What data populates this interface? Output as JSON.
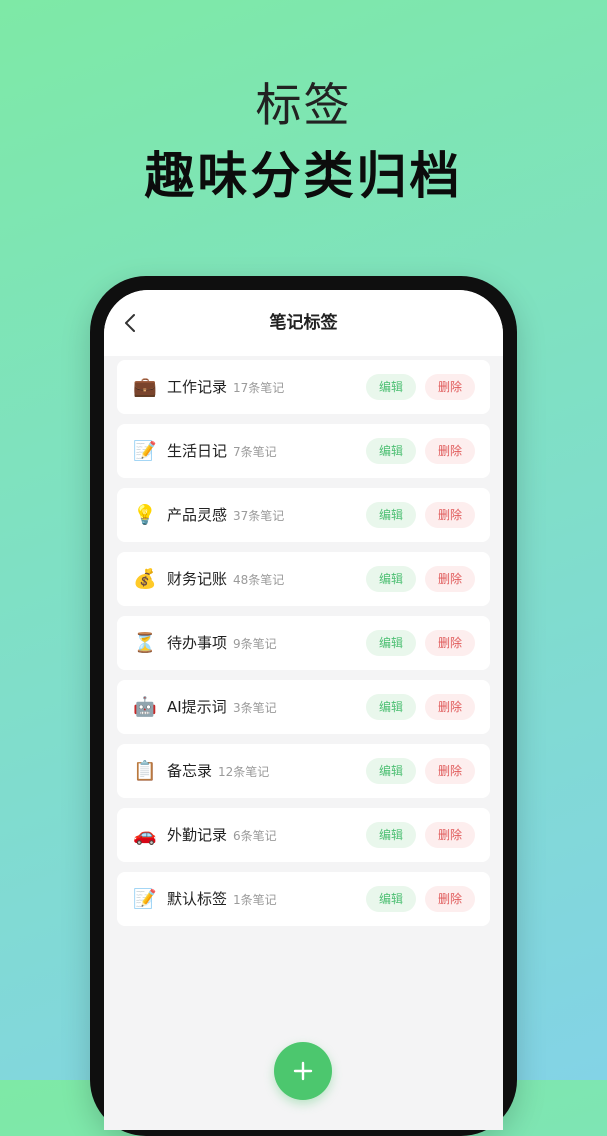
{
  "promo": {
    "title": "标签",
    "subtitle": "趣味分类归档"
  },
  "nav": {
    "title": "笔记标签",
    "back_icon": "chevron-left-icon"
  },
  "actions": {
    "edit_label": "编辑",
    "delete_label": "删除"
  },
  "tags": [
    {
      "icon": "💼",
      "icon_name": "briefcase-icon",
      "name": "工作记录",
      "count": "17条笔记"
    },
    {
      "icon": "📝",
      "icon_name": "memo-icon",
      "name": "生活日记",
      "count": "7条笔记"
    },
    {
      "icon": "💡",
      "icon_name": "lightbulb-icon",
      "name": "产品灵感",
      "count": "37条笔记"
    },
    {
      "icon": "💰",
      "icon_name": "money-bag-icon",
      "name": "财务记账",
      "count": "48条笔记"
    },
    {
      "icon": "⏳",
      "icon_name": "hourglass-icon",
      "name": "待办事项",
      "count": "9条笔记"
    },
    {
      "icon": "🤖",
      "icon_name": "robot-icon",
      "name": "AI提示词",
      "count": "3条笔记"
    },
    {
      "icon": "📋",
      "icon_name": "clipboard-icon",
      "name": "备忘录",
      "count": "12条笔记"
    },
    {
      "icon": "🚗",
      "icon_name": "car-icon",
      "name": "外勤记录",
      "count": "6条笔记"
    },
    {
      "icon": "📝",
      "icon_name": "memo-icon",
      "name": "默认标签",
      "count": "1条笔记"
    }
  ],
  "add_button": {
    "icon": "plus-icon"
  },
  "colors": {
    "accent_green": "#4cc76e",
    "edit_text": "#4cbf72",
    "edit_bg": "#e9f7ec",
    "delete_text": "#e05a5a",
    "delete_bg": "#fdeeee",
    "gradient_start": "#7ee9a6",
    "gradient_end": "#83d3e6"
  }
}
